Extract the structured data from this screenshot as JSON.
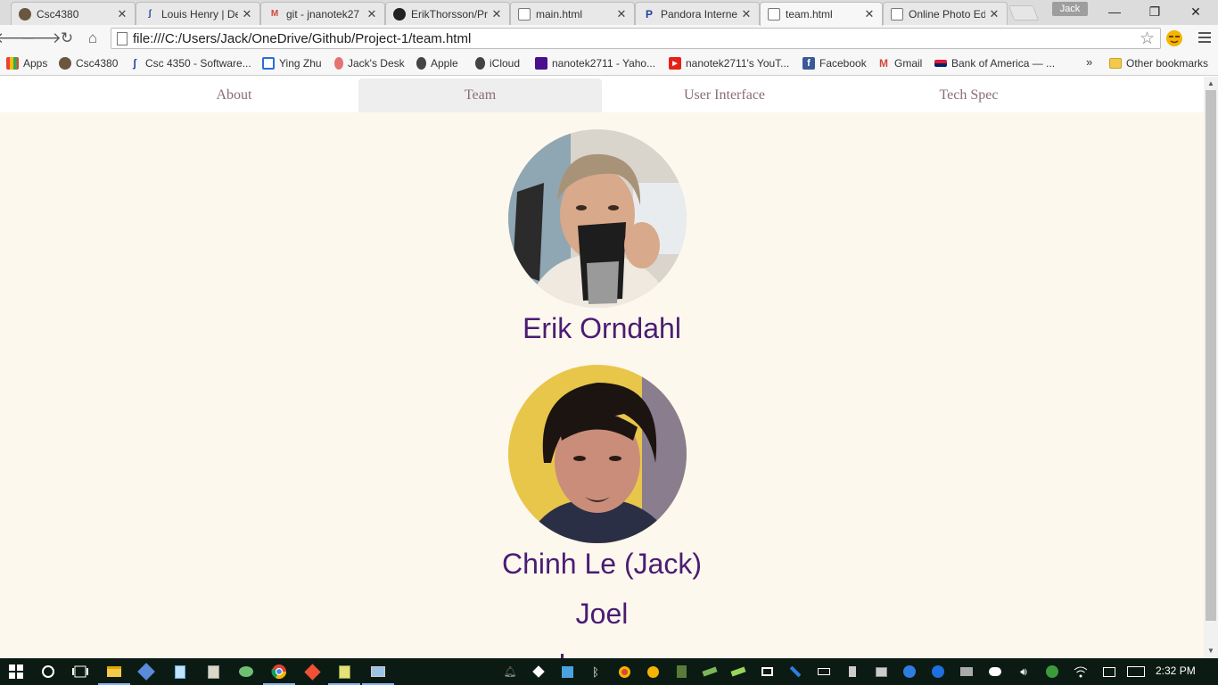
{
  "browser": {
    "tabs": [
      {
        "title": "Csc4380",
        "icon": "owl-icon"
      },
      {
        "title": "Louis Henry | De",
        "icon": "gsu-icon"
      },
      {
        "title": "git - jnanotek27",
        "icon": "gmail-icon"
      },
      {
        "title": "ErikThorsson/Pr",
        "icon": "github-icon"
      },
      {
        "title": "main.html",
        "icon": "page-icon"
      },
      {
        "title": "Pandora Interne",
        "icon": "pandora-icon"
      },
      {
        "title": "team.html",
        "icon": "page-icon",
        "active": true
      },
      {
        "title": "Online Photo Ed",
        "icon": "page-icon"
      }
    ],
    "profile_name": "Jack",
    "url": "file:///C:/Users/Jack/OneDrive/Github/Project-1/team.html",
    "bookmarks": [
      {
        "label": "Apps",
        "icon": "apps-grid-icon"
      },
      {
        "label": "Csc4380",
        "icon": "owl-icon"
      },
      {
        "label": "Csc 4350 - Software...",
        "icon": "gsu-icon"
      },
      {
        "label": "Ying Zhu",
        "icon": "page-frame-icon"
      },
      {
        "label": "Jack's Desk",
        "icon": "evernote-icon"
      },
      {
        "label": "Apple",
        "icon": "apple-icon"
      },
      {
        "label": "iCloud",
        "icon": "apple-icon"
      },
      {
        "label": "nanotek2711 - Yaho...",
        "icon": "yahoo-mail-icon"
      },
      {
        "label": "nanotek2711's YouT...",
        "icon": "youtube-icon"
      },
      {
        "label": "Facebook",
        "icon": "facebook-icon"
      },
      {
        "label": "Gmail",
        "icon": "gmail-icon"
      },
      {
        "label": "Bank of America — ...",
        "icon": "boa-icon"
      }
    ],
    "more_bookmarks": "»",
    "other_bookmarks": "Other bookmarks"
  },
  "site": {
    "nav": [
      {
        "label": "About"
      },
      {
        "label": "Team",
        "current": true
      },
      {
        "label": "User Interface"
      },
      {
        "label": "Tech Spec"
      }
    ],
    "members": [
      {
        "name": "Erik Orndahl",
        "has_photo": true
      },
      {
        "name": "Chinh Le (Jack)",
        "has_photo": true
      },
      {
        "name": "Joel",
        "has_photo": false
      }
    ]
  },
  "taskbar": {
    "time": "2:32 PM"
  },
  "colors": {
    "page_bg": "#fdf8ed",
    "name_color": "#4b1c74",
    "nav_text": "#8a6e74"
  }
}
